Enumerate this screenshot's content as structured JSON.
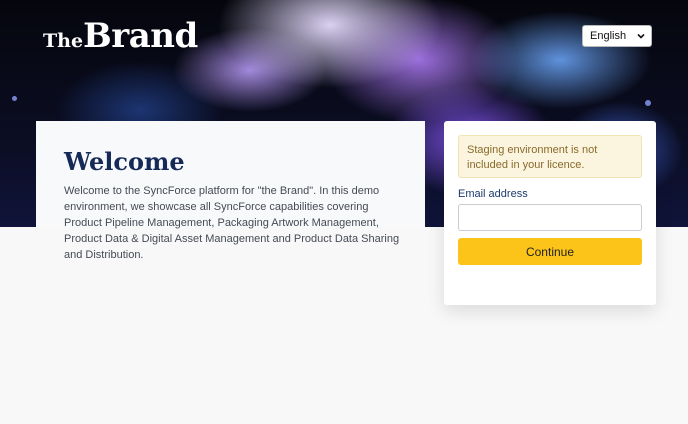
{
  "brand": {
    "prefix": "The",
    "name": "Brand"
  },
  "language": {
    "selected": "English"
  },
  "welcome": {
    "title": "Welcome",
    "text": "Welcome to the SyncForce platform for \"the Brand\". In this demo environment, we showcase all SyncForce capabilities covering Product Pipeline Management, Packaging Artwork Management, Product Data & Digital Asset Management and Product Data Sharing and Distribution."
  },
  "login": {
    "alert": "Staging environment is not included in your licence.",
    "email_label": "Email address",
    "email_value": "",
    "email_placeholder": "",
    "continue_label": "Continue"
  },
  "colors": {
    "accent": "#fcc419",
    "title": "#162a57",
    "alert_bg": "#fbf5df",
    "alert_text": "#8a6a2a"
  },
  "icons": {
    "language_dropdown": "chevron-down-icon"
  }
}
